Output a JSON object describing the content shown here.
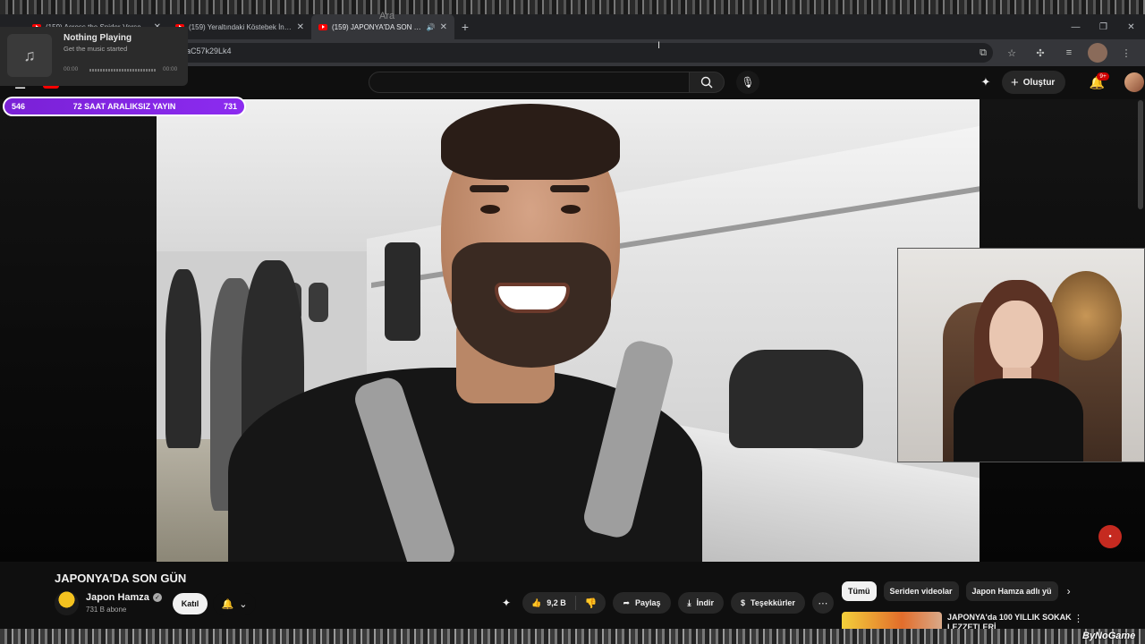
{
  "browser": {
    "tabs": [
      {
        "title": "(159) Across the Spider-Verse...",
        "active": false
      },
      {
        "title": "(159) Yeraltındaki Köstebek İnsanlar",
        "active": false
      },
      {
        "title": "(159) JAPONYA'DA SON GÜN",
        "active": true
      }
    ],
    "new_tab": "+",
    "url_fragment": "aC57k29Lk4"
  },
  "music_popup": {
    "title": "Nothing Playing",
    "subtitle": "Get the music started",
    "time_start": "00:00",
    "time_end": "00:00"
  },
  "youtube": {
    "logo_text": "YouTube",
    "search_placeholder": "Ara",
    "create_label": "Oluştur",
    "notifications_badge": "9+"
  },
  "stream_overlay": {
    "left_count": "546",
    "label": "72 SAAT ARALIKSIZ YAYIN",
    "right_count": "731"
  },
  "video": {
    "title": "JAPONYA'DA SON GÜN",
    "channel_name": "Japon Hamza",
    "subscribers": "731 B abone",
    "join_label": "Katıl",
    "likes": "9,2 B",
    "share_label": "Paylaş",
    "download_label": "İndir",
    "thanks_label": "Teşekkürler"
  },
  "recommendations": {
    "chips": [
      "Tümü",
      "Seriden videolar",
      "Japon Hamza adlı yü"
    ],
    "first_title": "JAPONYA'da 100 YILLIK SOKAK LEZZETLERİ"
  },
  "watermark": "ByNoGame",
  "colors": {
    "youtube_red": "#ff0000",
    "overlay_purple": "#8c2bf0",
    "background": "#0f0f0f"
  }
}
